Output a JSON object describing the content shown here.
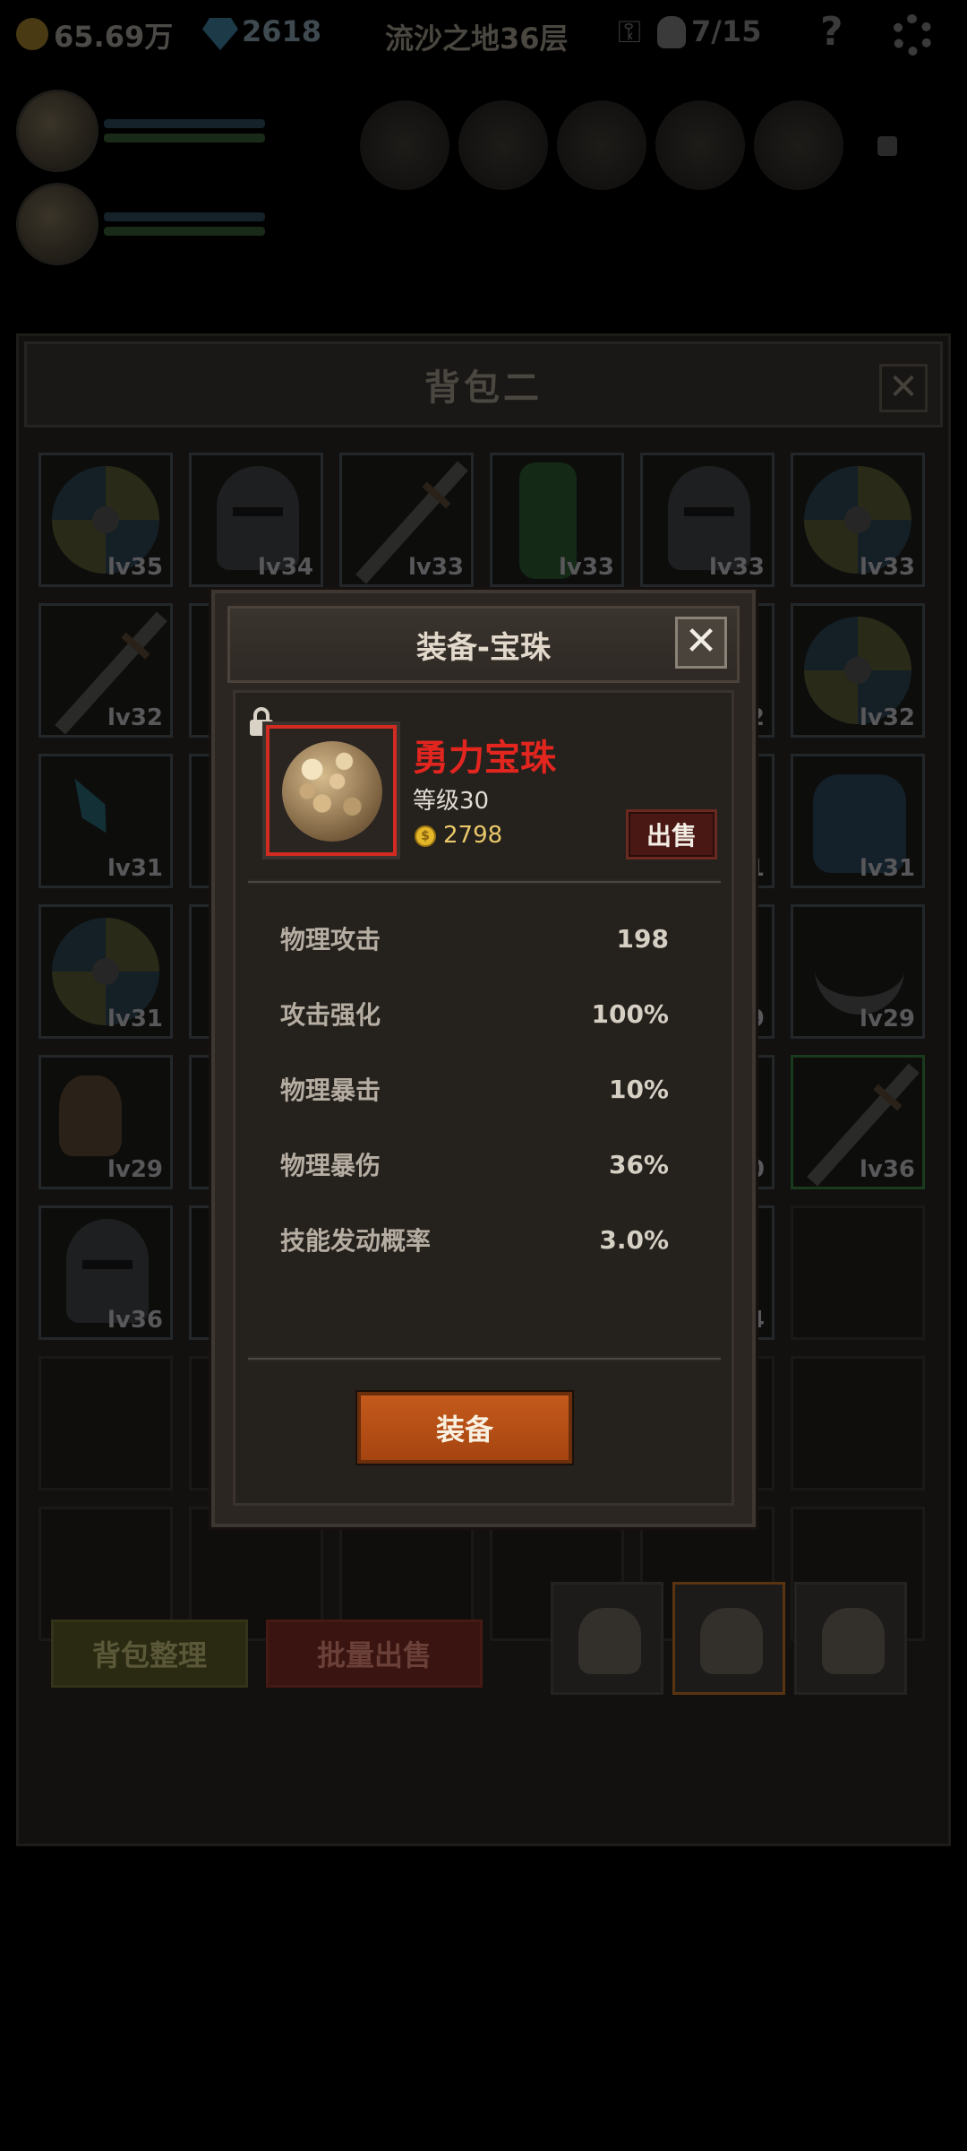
{
  "hud": {
    "gold": "65.69万",
    "gems": "2618",
    "stage": "流沙之地36层",
    "kills": "7/15",
    "help": "?"
  },
  "bag": {
    "title": "背包二",
    "close": "✕",
    "cells": [
      {
        "icon": "shield-icon",
        "lv": "lv35"
      },
      {
        "icon": "helmet-icon",
        "lv": "lv34"
      },
      {
        "icon": "sword-icon",
        "lv": "lv33"
      },
      {
        "icon": "gauntlet-icon",
        "lv": "lv33"
      },
      {
        "icon": "helmet-icon",
        "lv": "lv33"
      },
      {
        "icon": "shield-icon",
        "lv": "lv33"
      },
      {
        "icon": "sword-icon",
        "lv": "lv32"
      },
      {
        "icon": "hidden",
        "lv": ""
      },
      {
        "icon": "hidden",
        "lv": ""
      },
      {
        "icon": "hidden",
        "lv": ""
      },
      {
        "icon": "hidden",
        "lv": "2"
      },
      {
        "icon": "shield-icon",
        "lv": "lv32"
      },
      {
        "icon": "dagger-icon",
        "lv": "lv31"
      },
      {
        "icon": "hidden",
        "lv": ""
      },
      {
        "icon": "hidden",
        "lv": ""
      },
      {
        "icon": "hidden",
        "lv": ""
      },
      {
        "icon": "hidden",
        "lv": "1"
      },
      {
        "icon": "armor-icon",
        "lv": "lv31"
      },
      {
        "icon": "shield-icon",
        "lv": "lv31"
      },
      {
        "icon": "hidden",
        "lv": ""
      },
      {
        "icon": "hidden",
        "lv": ""
      },
      {
        "icon": "hidden",
        "lv": ""
      },
      {
        "icon": "hidden",
        "lv": "9"
      },
      {
        "icon": "sickle-icon",
        "lv": "lv29"
      },
      {
        "icon": "scroll-icon",
        "lv": "lv29"
      },
      {
        "icon": "hidden",
        "lv": ""
      },
      {
        "icon": "hidden",
        "lv": ""
      },
      {
        "icon": "hidden",
        "lv": ""
      },
      {
        "icon": "hidden",
        "lv": "0"
      },
      {
        "icon": "sword-icon",
        "lv": "lv36"
      },
      {
        "icon": "helmet-icon",
        "lv": "lv36"
      },
      {
        "icon": "hidden",
        "lv": ""
      },
      {
        "icon": "hidden",
        "lv": ""
      },
      {
        "icon": "hidden",
        "lv": ""
      },
      {
        "icon": "hidden",
        "lv": "4"
      },
      {
        "icon": "empty",
        "lv": ""
      }
    ],
    "sort_label": "背包整理",
    "batch_sell_label": "批量出售"
  },
  "dialog": {
    "title": "装备-宝珠",
    "close": "✕",
    "item": {
      "name": "勇力宝珠",
      "level": "等级30",
      "coin_symbol": "$",
      "price": "2798",
      "sell_label": "出售"
    },
    "stats": [
      {
        "name": "物理攻击",
        "value": "198"
      },
      {
        "name": "攻击强化",
        "value": "100%"
      },
      {
        "name": "物理暴击",
        "value": "10%"
      },
      {
        "name": "物理暴伤",
        "value": "36%"
      },
      {
        "name": "技能发动概率",
        "value": "3.0%"
      }
    ],
    "equip_label": "装备"
  }
}
